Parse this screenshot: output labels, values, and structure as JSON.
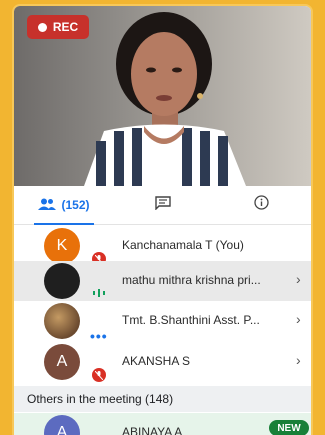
{
  "recording": {
    "label": "REC",
    "color": "#c7312b"
  },
  "tabs": [
    {
      "icon": "people-icon",
      "label": "(152)"
    },
    {
      "icon": "chat-icon",
      "label": ""
    },
    {
      "icon": "info-icon",
      "label": ""
    }
  ],
  "participants": [
    {
      "name": "Kanchanamala T (You)",
      "avatar_letter": "K",
      "avatar_color": "#e8710a",
      "status_icon": "mic-off-icon"
    },
    {
      "name": "mathu mithra krishna pri...",
      "avatar_letter": "",
      "avatar_color": "#1f1f1f",
      "status_icon": "audio-wave-icon"
    },
    {
      "name": "Tmt. B.Shanthini Asst. P...",
      "avatar_letter": "",
      "avatar_color": "#8a5a3c",
      "status_icon": "more-dots-icon"
    },
    {
      "name": "AKANSHA S",
      "avatar_letter": "A",
      "avatar_color": "#7a4b3b",
      "status_icon": "mic-off-icon"
    }
  ],
  "others": {
    "header": "Others in the meeting (148)",
    "items": [
      {
        "name": "ABINAYA A",
        "avatar_letter": "A",
        "avatar_color": "#5c6bc0",
        "badge": "NEW",
        "status_icon": "mic-off-icon"
      }
    ]
  }
}
